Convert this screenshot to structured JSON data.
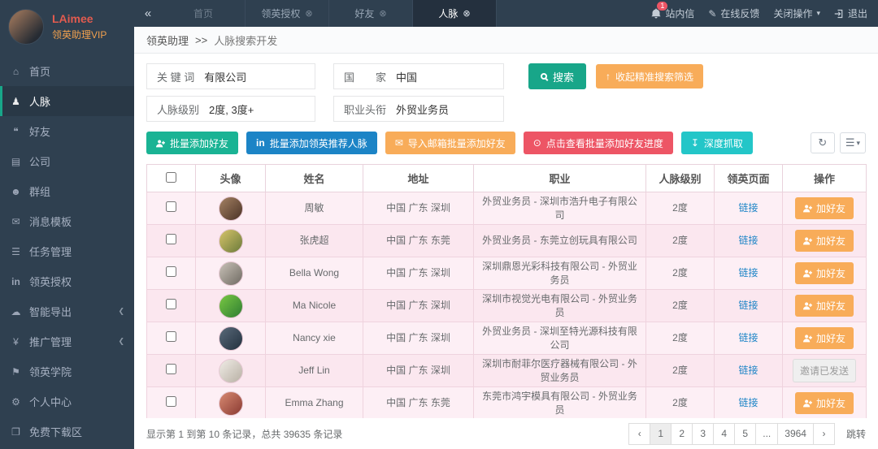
{
  "topbar": {
    "collapse_icon": "«",
    "tabs": {
      "home": "首页",
      "auth": "领英授权",
      "friends": "好友",
      "contacts": "人脉"
    },
    "close_glyph": "⊗",
    "messages": {
      "label": "站内信",
      "badge": "1"
    },
    "feedback": "在线反馈",
    "close_ops": "关闭操作",
    "logout": "退出"
  },
  "sidebar": {
    "user": {
      "name": "LAimee",
      "role": "领英助理VIP"
    },
    "items": [
      {
        "label": "首页",
        "icon": "home-icon"
      },
      {
        "label": "人脉",
        "icon": "contacts-icon",
        "active": true
      },
      {
        "label": "好友",
        "icon": "chat-icon"
      },
      {
        "label": "公司",
        "icon": "company-icon"
      },
      {
        "label": "群组",
        "icon": "groups-icon"
      },
      {
        "label": "消息模板",
        "icon": "envelope-icon"
      },
      {
        "label": "任务管理",
        "icon": "tasks-icon"
      },
      {
        "label": "领英授权",
        "icon": "linkedin-icon"
      },
      {
        "label": "智能导出",
        "icon": "cloud-icon",
        "expandable": true
      },
      {
        "label": "推广管理",
        "icon": "yen-icon",
        "expandable": true
      },
      {
        "label": "领英学院",
        "icon": "academy-icon"
      },
      {
        "label": "个人中心",
        "icon": "gear-icon"
      },
      {
        "label": "免费下载区",
        "icon": "download-area-icon"
      }
    ]
  },
  "breadcrumb": {
    "app": "领英助理",
    "sep": ">>",
    "page": "人脉搜索开发"
  },
  "filters": {
    "keyword": {
      "label": "关 键 词",
      "value": "有限公司"
    },
    "country": {
      "label": "国　　家",
      "value": "中国"
    },
    "level": {
      "label": "人脉级别",
      "value": "2度, 3度+"
    },
    "job_title": {
      "label": "职业头衔",
      "value": "外贸业务员"
    },
    "search_label": "搜索",
    "collapse_label": "收起精准搜索筛选"
  },
  "actions": {
    "batch_add": "批量添加好友",
    "linkedin_prefix": "in",
    "batch_add_recommended": "批量添加领英推荐人脉",
    "import_email": "导入邮箱批量添加好友",
    "view_progress": "点击查看批量添加好友进度",
    "deep_fetch": "深度抓取"
  },
  "table": {
    "headers": {
      "avatar": "头像",
      "name": "姓名",
      "address": "地址",
      "job": "职业",
      "level": "人脉级别",
      "page": "领英页面",
      "action": "操作"
    },
    "rows": [
      {
        "name": "周敏",
        "address": "中国 广东 深圳",
        "job": "外贸业务员 - 深圳市浩升电子有限公司",
        "level": "2度",
        "link": "链接",
        "action": "加好友",
        "avatar_colors": [
          "#a58263",
          "#4a3226"
        ]
      },
      {
        "name": "张虎超",
        "address": "中国 广东 东莞",
        "job": "外贸业务员 - 东莞立创玩具有限公司",
        "level": "2度",
        "link": "链接",
        "action": "加好友",
        "avatar_colors": [
          "#d8c46a",
          "#6a7a3a"
        ]
      },
      {
        "name": "Bella Wong",
        "address": "中国 广东 深圳",
        "job": "深圳鼎恩光彩科技有限公司 - 外贸业务员",
        "level": "2度",
        "link": "链接",
        "action": "加好友",
        "avatar_colors": [
          "#c9c2b8",
          "#6f6a62"
        ]
      },
      {
        "name": "Ma Nicole",
        "address": "中国 广东 深圳",
        "job": "深圳市视觉光电有限公司 - 外贸业务员",
        "level": "2度",
        "link": "链接",
        "action": "加好友",
        "avatar_colors": [
          "#7ac943",
          "#2e7d32"
        ]
      },
      {
        "name": "Nancy xie",
        "address": "中国 广东 深圳",
        "job": "外贸业务员 - 深圳至特光源科技有限公司",
        "level": "2度",
        "link": "链接",
        "action": "加好友",
        "avatar_colors": [
          "#5a6a7a",
          "#22303e"
        ]
      },
      {
        "name": "Jeff Lin",
        "address": "中国 广东 深圳",
        "job": "深圳市耐菲尔医疗器械有限公司 - 外贸业务员",
        "level": "2度",
        "link": "链接",
        "action": "邀请已发送",
        "avatar_colors": [
          "#f0ece6",
          "#b8b0a4"
        ]
      },
      {
        "name": "Emma Zhang",
        "address": "中国 广东 东莞",
        "job": "东莞市鸿宇模具有限公司 - 外贸业务员",
        "level": "2度",
        "link": "链接",
        "action": "加好友",
        "avatar_colors": [
          "#d88a72",
          "#8a3a32"
        ]
      }
    ]
  },
  "footer": {
    "summary": "显示第 1 到第 10 条记录，总共 39635 条记录",
    "pages": [
      {
        "label": "‹"
      },
      {
        "label": "1",
        "active": true
      },
      {
        "label": "2"
      },
      {
        "label": "3"
      },
      {
        "label": "4"
      },
      {
        "label": "5"
      },
      {
        "label": "..."
      },
      {
        "label": "3964"
      },
      {
        "label": "›"
      }
    ],
    "jump": "跳转"
  },
  "colors": {
    "green": "#18a689",
    "blue": "#1c84c6",
    "orange": "#f8ac59",
    "red": "#ed5565",
    "teal": "#23c6c8",
    "sidebar": "#2f4050"
  }
}
